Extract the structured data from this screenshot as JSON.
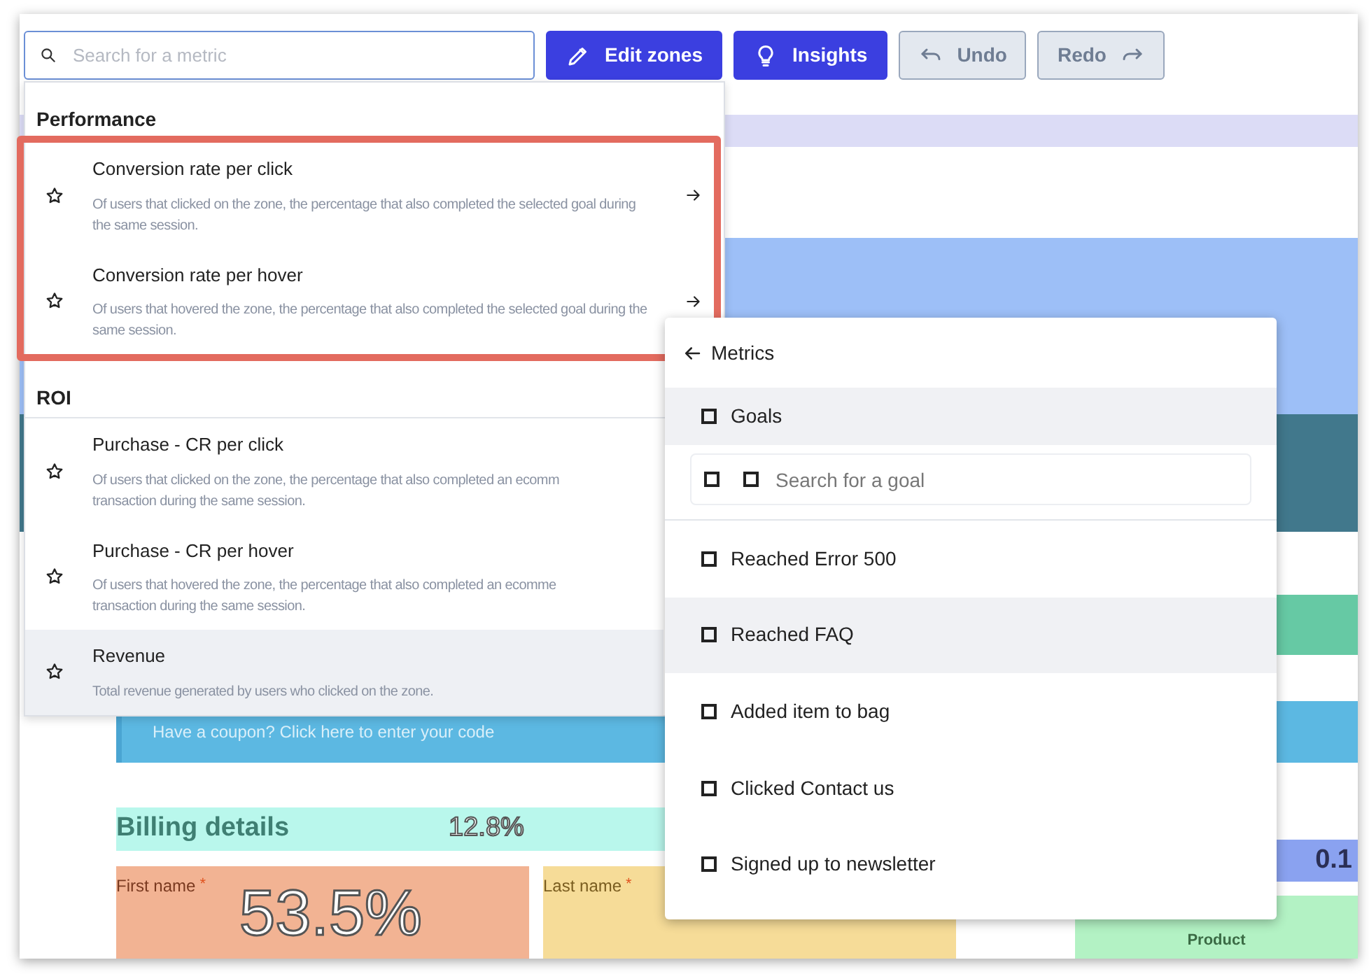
{
  "toolbar": {
    "search": {
      "placeholder": "Search for a metric"
    },
    "buttons": [
      {
        "kind": "primary",
        "label": "Edit zones",
        "disabled": false
      },
      {
        "kind": "primary",
        "label": "Insights",
        "disabled": false
      },
      {
        "kind": "secondary",
        "label": "Undo",
        "disabled": true
      },
      {
        "kind": "secondary",
        "label": "Redo",
        "disabled": true
      }
    ]
  },
  "page": {
    "coupon": "Have a coupon? Click here to enter your code",
    "billing_title": "Billing details",
    "billing_rate": "12.8%",
    "fields": [
      {
        "label": "First name",
        "required": "*",
        "rate": "53.5%"
      },
      {
        "label": "Last name",
        "required": "*"
      }
    ],
    "product": "Product",
    "side_rate": "0.1"
  },
  "metric_menu": {
    "sections": [
      {
        "title": "Performance",
        "outlined": true,
        "items": [
          {
            "title": "Conversion rate per click",
            "description": "Of users that clicked on the zone, the percentage that also completed the selected goal during the same session.",
            "has_submenu": true,
            "highlighted": false
          },
          {
            "title": "Conversion rate per hover",
            "description": "Of users that hovered the zone, the percentage that also completed the selected goal during the same session.",
            "has_submenu": true,
            "highlighted": false
          }
        ]
      },
      {
        "title": "ROI",
        "outlined": false,
        "items": [
          {
            "title": "Purchase - CR per click",
            "description": "Of users that clicked on the zone, the percentage that also completed an ecomm",
            "description_2": "transaction during the same session.",
            "has_submenu": false,
            "highlighted": false
          },
          {
            "title": "Purchase - CR per hover",
            "description": "Of users that hovered the zone, the percentage that also completed an ecomme",
            "description_2": "transaction during the same session.",
            "has_submenu": false,
            "highlighted": false
          },
          {
            "title": "Revenue",
            "description": "Total revenue generated by users who clicked on the zone.",
            "has_submenu": false,
            "highlighted": true
          }
        ]
      }
    ]
  },
  "goals_panel": {
    "title": "Metrics",
    "items": [
      {
        "kind": "header",
        "label": "Goals",
        "checked": false,
        "highlighted": true
      },
      {
        "kind": "search",
        "placeholder": "Search for a goal",
        "checked": false,
        "highlighted": false
      },
      {
        "kind": "goal",
        "label": "Reached Error 500",
        "checked": false,
        "highlighted": false
      },
      {
        "kind": "goal",
        "label": "Reached FAQ",
        "checked": false,
        "highlighted": true
      },
      {
        "kind": "goal",
        "label": "Added item to bag",
        "checked": false,
        "highlighted": false
      },
      {
        "kind": "goal",
        "label": "Clicked Contact us",
        "checked": false,
        "highlighted": false
      },
      {
        "kind": "goal",
        "label": "Signed up to newsletter",
        "checked": false,
        "highlighted": false
      }
    ]
  }
}
